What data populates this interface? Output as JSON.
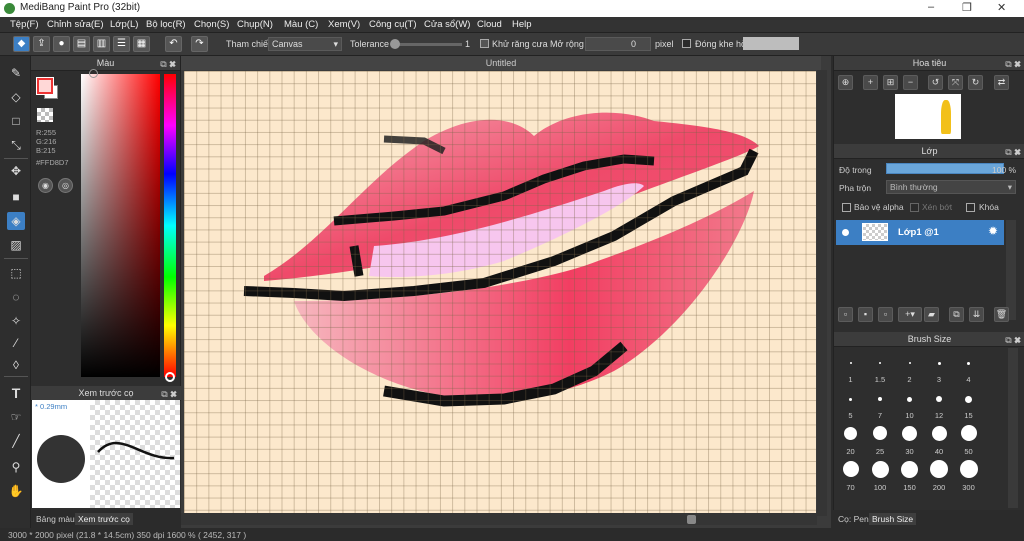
{
  "window": {
    "title": "MediBang Paint Pro (32bit)",
    "controls": [
      "–",
      "❐",
      "✕"
    ]
  },
  "menu": [
    "Tệp(F)",
    "Chỉnh sửa(E)",
    "Lớp(L)",
    "Bộ lọc(R)",
    "Chọn(S)",
    "Chụp(N)",
    "Màu (C)",
    "Xem(V)",
    "Công cụ(T)",
    "Cửa sổ(W)",
    "Cloud",
    "Help"
  ],
  "toolbar": {
    "reference_label": "Tham chiếu",
    "reference_value": "Canvas",
    "tolerance_label": "Tolerance",
    "tolerance_value": "1",
    "antialias_label": "Khử răng cưa",
    "expand_label": "Mở rộng",
    "expand_value": "0",
    "unit": "pixel",
    "closegap_label": "Đóng khe hở"
  },
  "colorpanel": {
    "title": "Màu",
    "r": "R:255",
    "g": "G:216",
    "b": "B:215",
    "hex": "#FFD8D7",
    "fg_color": "#FFD8D7"
  },
  "preview": {
    "title": "Xem trước cọ",
    "size": "* 0.29mm"
  },
  "left_tabs": [
    "Bảng màu",
    "Xem trước cọ"
  ],
  "document": {
    "tab": "Untitled"
  },
  "navigator": {
    "title": "Hoa tiêu"
  },
  "layers": {
    "title": "Lớp",
    "opacity_label": "Độ trong",
    "opacity_value": "100 %",
    "blend_label": "Pha trộn",
    "blend_value": "Bình thường",
    "protect_alpha": "Bảo vệ alpha",
    "clipping": "Xén bớt",
    "lock": "Khóa",
    "layer_name": "Lớp1 @1"
  },
  "brushsize": {
    "title": "Brush Size",
    "sizes": [
      "1",
      "1.5",
      "2",
      "3",
      "4",
      "5",
      "7",
      "10",
      "12",
      "15",
      "20",
      "25",
      "30",
      "40",
      "50",
      "70",
      "100",
      "150",
      "200",
      "300"
    ]
  },
  "right_tabs": [
    "Cọ: Pen",
    "Brush Size"
  ],
  "status": "3000 * 2000 pixel   (21.8 * 14.5cm)   350 dpi   1600 %   ( 2452, 317 )"
}
